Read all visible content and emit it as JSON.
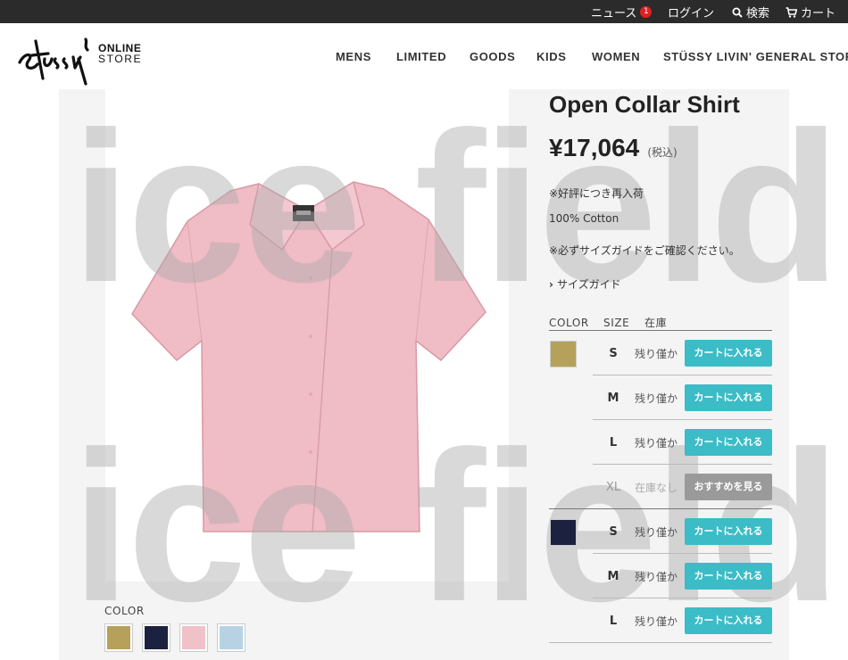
{
  "topbar": {
    "news_label": "ニュース",
    "news_count": "1",
    "login_label": "ログイン",
    "search_label": "検索",
    "cart_label": "カート"
  },
  "brand": {
    "logo_line1": "ONLINE",
    "logo_line2": "STORE"
  },
  "nav": {
    "items": [
      "MENS",
      "LIMITED",
      "GOODS",
      "KIDS",
      "WOMEN",
      "STÜSSY LIVIN' GENERAL STORE"
    ]
  },
  "watermark": {
    "line1": "ice field",
    "line2": "ice field"
  },
  "product": {
    "title": "Open Collar Shirt",
    "price": "¥17,064",
    "tax_note": "(税込)",
    "restock_note": "※好評につき再入荷",
    "material": "100% Cotton",
    "size_note": "※必ずサイズガイドをご確認ください。",
    "size_guide_label": "サイズガイド"
  },
  "stock_table": {
    "headers": {
      "color": "COLOR",
      "size": "SIZE",
      "stock": "在庫"
    },
    "groups": [
      {
        "color_hex": "#b5a15a",
        "rows": [
          {
            "size": "S",
            "stock": "残り僅か",
            "button": "カートに入れる",
            "available": true
          },
          {
            "size": "M",
            "stock": "残り僅か",
            "button": "カートに入れる",
            "available": true
          },
          {
            "size": "L",
            "stock": "残り僅か",
            "button": "カートに入れる",
            "available": true
          },
          {
            "size": "XL",
            "stock": "在庫なし",
            "button": "おすすめを見る",
            "available": false
          }
        ]
      },
      {
        "color_hex": "#1c2140",
        "rows": [
          {
            "size": "S",
            "stock": "残り僅か",
            "button": "カートに入れる",
            "available": true
          },
          {
            "size": "M",
            "stock": "残り僅か",
            "button": "カートに入れる",
            "available": true
          },
          {
            "size": "L",
            "stock": "残り僅か",
            "button": "カートに入れる",
            "available": true
          }
        ]
      }
    ]
  },
  "gallery": {
    "color_label": "COLOR",
    "thumbs": [
      {
        "name": "tan",
        "hex": "#b5a15a"
      },
      {
        "name": "navy",
        "hex": "#1c2140"
      },
      {
        "name": "pink",
        "hex": "#f1c1c9"
      },
      {
        "name": "light-blue",
        "hex": "#b7d3e3"
      }
    ]
  },
  "colors": {
    "accent": "#3bbcc6",
    "disabled": "#9a9a9a",
    "topbar": "#2b2b2b",
    "badge": "#e02020"
  }
}
